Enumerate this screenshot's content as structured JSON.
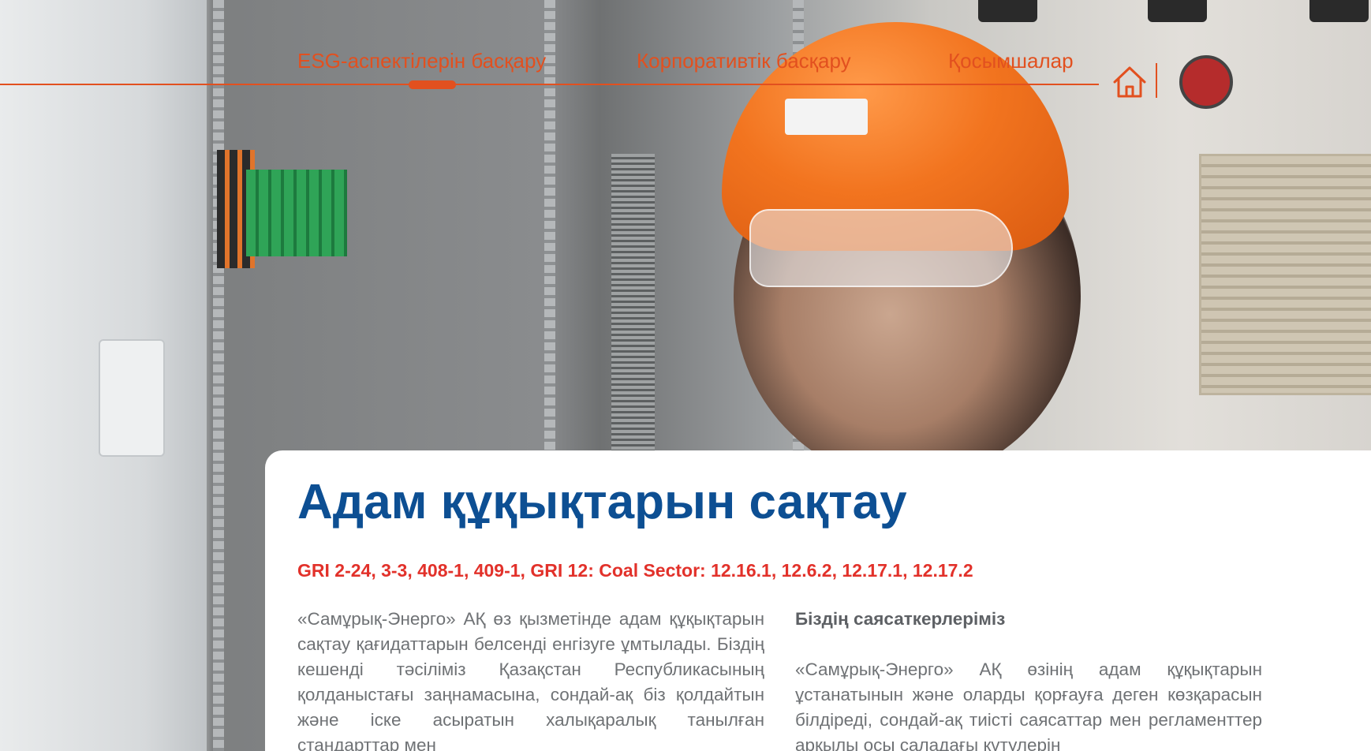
{
  "nav": {
    "items": [
      {
        "label": "ESG-аспектілерін басқару",
        "active": true
      },
      {
        "label": "Корпоративтік басқару",
        "active": false
      },
      {
        "label": "Қосымшалар",
        "active": false
      }
    ],
    "home_icon": "home-icon",
    "accent_color": "#e2501f"
  },
  "hero": {
    "image": "photo-engineer-woman-orange-helmet-at-control-panel"
  },
  "article": {
    "title": "Адам құқықтарын сақтау",
    "gri_refs": "GRI 2-24, 3-3, 408-1, 409-1, GRI 12: Coal Sector: 12.16.1, 12.6.2, 12.17.1, 12.17.2",
    "left_column": {
      "text": "«Самұрық-Энерго» АҚ өз қызметінде адам құқықтарын сақтау қағидаттарын белсенді енгізуге ұмтылады. Біздің кешенді тәсіліміз Қазақстан Республикасының қолданыстағы заңнамасына, сондай-ақ біз қолдайтын және іске асыратын халықаралық танылған стандарттар мен"
    },
    "right_column": {
      "heading": "Біздің саясаткерлеріміз",
      "text": "«Самұрық-Энерго» АҚ өзінің адам құқықтарын ұстанатынын және оларды қорғауға деген көзқарасын білдіреді, сондай-ақ тиісті саясаттар мен регламенттер арқылы осы саладағы күтулерін"
    },
    "title_color": "#0d4f93",
    "gri_color": "#e2312a"
  }
}
